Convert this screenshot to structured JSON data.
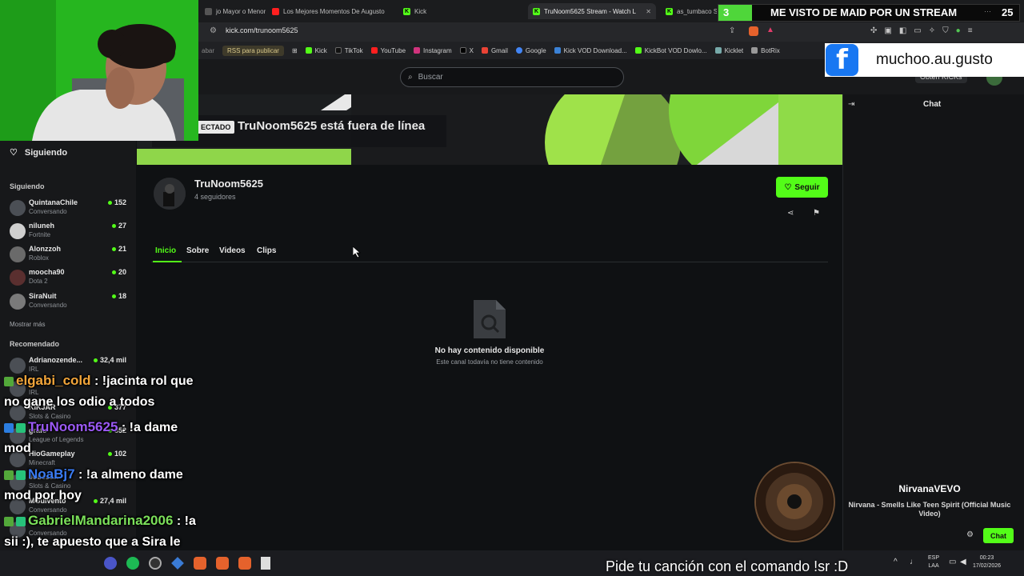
{
  "browser": {
    "tabs": [
      {
        "label": "jo Mayor o Menor",
        "icon": "tab-icon",
        "active": false
      },
      {
        "label": "Los Mejores Momentos De Augusto",
        "icon": "youtube-icon",
        "active": false
      },
      {
        "label": "Kick",
        "icon": "kick-icon",
        "active": false
      },
      {
        "label": "TruNoom5625 Stream - Watch L",
        "icon": "kick-icon",
        "active": true
      },
      {
        "label": "as_tumbaco S",
        "icon": "kick-icon",
        "active": false
      }
    ],
    "url": "kick.com/trunoom5625",
    "bookmarks": [
      "abar",
      "RSS para publicar",
      "Kick",
      "TikTok",
      "YouTube",
      "Instagram",
      "X",
      "Gmail",
      "Google",
      "Kick VOD Download...",
      "KickBot VOD Dowlo...",
      "Kicklet",
      "BotRix"
    ]
  },
  "page": {
    "search_placeholder": "Buscar",
    "kicks_button": "Obtén KICKs",
    "banner": {
      "badge": "ECTADO",
      "offline_text": "TruNoom5625 está fuera de línea"
    },
    "channel": {
      "name": "TruNoom5625",
      "followers": "4 seguidores",
      "follow_label": "Seguir",
      "tabs": [
        "Inicio",
        "Sobre",
        "Videos",
        "Clips"
      ],
      "active_tab": "Inicio",
      "empty_title": "No hay contenido disponible",
      "empty_sub": "Este canal todavía no tiene contenido"
    },
    "chat": {
      "title": "Chat",
      "button": "Chat"
    }
  },
  "sidebar": {
    "following_header": "Siguiendo",
    "following_label": "Siguiendo",
    "following": [
      {
        "name": "QuintanaChile",
        "category": "Conversando",
        "viewers": "152"
      },
      {
        "name": "niluneh",
        "category": "Fortnite",
        "viewers": "27"
      },
      {
        "name": "Alonzzoh",
        "category": "Roblox",
        "viewers": "21"
      },
      {
        "name": "moocha90",
        "category": "Dota 2",
        "viewers": "20"
      },
      {
        "name": "SiraNuit",
        "category": "Conversando",
        "viewers": "18"
      }
    ],
    "show_more": "Mostrar más",
    "recommended_label": "Recomendado",
    "recommended": [
      {
        "name": "Adrianozende...",
        "category": "IRL",
        "viewers": "32,4 mil"
      },
      {
        "name": "",
        "category": "IRL",
        "viewers": ""
      },
      {
        "name": "KIKJAR",
        "category": "Slots & Casino",
        "viewers": "377"
      },
      {
        "name": "grafo",
        "category": "League of Legends",
        "viewers": "352"
      },
      {
        "name": "HioGameplay",
        "category": "Minecraft",
        "viewers": "102"
      },
      {
        "name": "Jobestin",
        "category": "Slots & Casino",
        "viewers": ""
      },
      {
        "name": "MGuivento",
        "category": "Conversando",
        "viewers": "27,4 mil"
      },
      {
        "name": "",
        "category": "Conversando",
        "viewers": ""
      }
    ]
  },
  "overlay": {
    "goal": {
      "count": "3",
      "title": "ME VISTO DE MAID POR UN STREAM",
      "target": "25",
      "progress": 0.12
    },
    "facebook_handle": "muchoo.au.gusto",
    "now_playing": {
      "artist": "NirvanaVEVO",
      "song": "Nirvana - Smells Like Teen Spirit (Official Music Video)"
    },
    "song_request": "Pide tu canción con el comando !sr :D",
    "chat_messages": [
      {
        "user": "elgabi_cold",
        "text": " : !jacinta rol que no gane los odio a todos",
        "color": "#f2a53a"
      },
      {
        "user": "TruNoom5625",
        "text": " : !a dame mod",
        "color": "#9b59f5"
      },
      {
        "user": "NoaBj7",
        "text": " : !a almeno dame mod por hoy",
        "color": "#3a7bf2"
      },
      {
        "user": "GabrielMandarina2006",
        "text": " : !a sii :), te apuesto que a Sira le encantará xd",
        "color": "#7be05a"
      }
    ]
  },
  "taskbar": {
    "lang1": "ESP",
    "lang2": "LAA",
    "time": "00:23",
    "date": "17/02/2026"
  },
  "colors": {
    "accent": "#53fc18",
    "bg": "#0f1113"
  }
}
